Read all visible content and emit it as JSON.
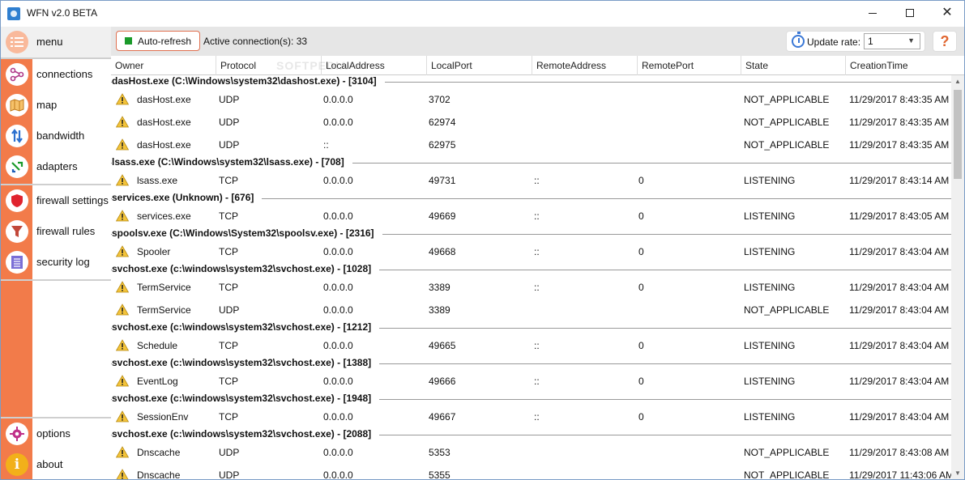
{
  "window": {
    "title": "WFN v2.0 BETA",
    "controls": {
      "minimize": "minimize",
      "maximize": "maximize",
      "close": "✕"
    }
  },
  "sidebar": {
    "items": [
      {
        "label": "menu",
        "icon": "menu-icon"
      },
      {
        "label": "connections",
        "icon": "connections-icon"
      },
      {
        "label": "map",
        "icon": "map-icon"
      },
      {
        "label": "bandwidth",
        "icon": "bandwidth-icon"
      },
      {
        "label": "adapters",
        "icon": "adapters-icon"
      },
      {
        "label": "firewall settings",
        "icon": "shield-icon"
      },
      {
        "label": "firewall rules",
        "icon": "funnel-icon"
      },
      {
        "label": "security log",
        "icon": "log-icon"
      },
      {
        "label": "options",
        "icon": "gear-icon"
      },
      {
        "label": "about",
        "icon": "info-icon"
      }
    ]
  },
  "toolbar": {
    "auto_refresh_label": "Auto-refresh",
    "active_connections": "Active connection(s): 33",
    "update_rate_label": "Update rate:",
    "update_rate_value": "1",
    "help_label": "?"
  },
  "columns": [
    "Owner",
    "Protocol",
    "LocalAddress",
    "LocalPort",
    "RemoteAddress",
    "RemotePort",
    "State",
    "CreationTime"
  ],
  "watermark": "SOFTPEDIA",
  "groups": [
    {
      "title": "dasHost.exe (C:\\Windows\\system32\\dashost.exe) - [3104]",
      "rows": [
        [
          "dasHost.exe",
          "UDP",
          "0.0.0.0",
          "3702",
          "",
          "",
          "NOT_APPLICABLE",
          "11/29/2017 8:43:35 AM"
        ],
        [
          "dasHost.exe",
          "UDP",
          "0.0.0.0",
          "62974",
          "",
          "",
          "NOT_APPLICABLE",
          "11/29/2017 8:43:35 AM"
        ],
        [
          "dasHost.exe",
          "UDP",
          "::",
          "62975",
          "",
          "",
          "NOT_APPLICABLE",
          "11/29/2017 8:43:35 AM"
        ]
      ]
    },
    {
      "title": "lsass.exe (C:\\Windows\\system32\\lsass.exe) - [708]",
      "rows": [
        [
          "lsass.exe",
          "TCP",
          "0.0.0.0",
          "49731",
          "::",
          "0",
          "LISTENING",
          "11/29/2017 8:43:14 AM"
        ]
      ]
    },
    {
      "title": "services.exe (Unknown) - [676]",
      "rows": [
        [
          "services.exe",
          "TCP",
          "0.0.0.0",
          "49669",
          "::",
          "0",
          "LISTENING",
          "11/29/2017 8:43:05 AM"
        ]
      ]
    },
    {
      "title": "spoolsv.exe (C:\\Windows\\System32\\spoolsv.exe) - [2316]",
      "rows": [
        [
          "Spooler",
          "TCP",
          "0.0.0.0",
          "49668",
          "::",
          "0",
          "LISTENING",
          "11/29/2017 8:43:04 AM"
        ]
      ]
    },
    {
      "title": "svchost.exe (c:\\windows\\system32\\svchost.exe) - [1028]",
      "rows": [
        [
          "TermService",
          "TCP",
          "0.0.0.0",
          "3389",
          "::",
          "0",
          "LISTENING",
          "11/29/2017 8:43:04 AM"
        ],
        [
          "TermService",
          "UDP",
          "0.0.0.0",
          "3389",
          "",
          "",
          "NOT_APPLICABLE",
          "11/29/2017 8:43:04 AM"
        ]
      ]
    },
    {
      "title": "svchost.exe (c:\\windows\\system32\\svchost.exe) - [1212]",
      "rows": [
        [
          "Schedule",
          "TCP",
          "0.0.0.0",
          "49665",
          "::",
          "0",
          "LISTENING",
          "11/29/2017 8:43:04 AM"
        ]
      ]
    },
    {
      "title": "svchost.exe (c:\\windows\\system32\\svchost.exe) - [1388]",
      "rows": [
        [
          "EventLog",
          "TCP",
          "0.0.0.0",
          "49666",
          "::",
          "0",
          "LISTENING",
          "11/29/2017 8:43:04 AM"
        ]
      ]
    },
    {
      "title": "svchost.exe (c:\\windows\\system32\\svchost.exe) - [1948]",
      "rows": [
        [
          "SessionEnv",
          "TCP",
          "0.0.0.0",
          "49667",
          "::",
          "0",
          "LISTENING",
          "11/29/2017 8:43:04 AM"
        ]
      ]
    },
    {
      "title": "svchost.exe (c:\\windows\\system32\\svchost.exe) - [2088]",
      "rows": [
        [
          "Dnscache",
          "UDP",
          "0.0.0.0",
          "5353",
          "",
          "",
          "NOT_APPLICABLE",
          "11/29/2017 8:43:08 AM"
        ],
        [
          "Dnscache",
          "UDP",
          "0.0.0.0",
          "5355",
          "",
          "",
          "NOT_APPLICABLE",
          "11/29/2017 11:43:06 AM"
        ]
      ]
    }
  ],
  "colors": {
    "sidebar_accent": "#f27b4a",
    "toolbar_bg": "#e6e6e6",
    "auto_refresh_indicator": "#1a9a2a",
    "help_color": "#e0652f"
  }
}
